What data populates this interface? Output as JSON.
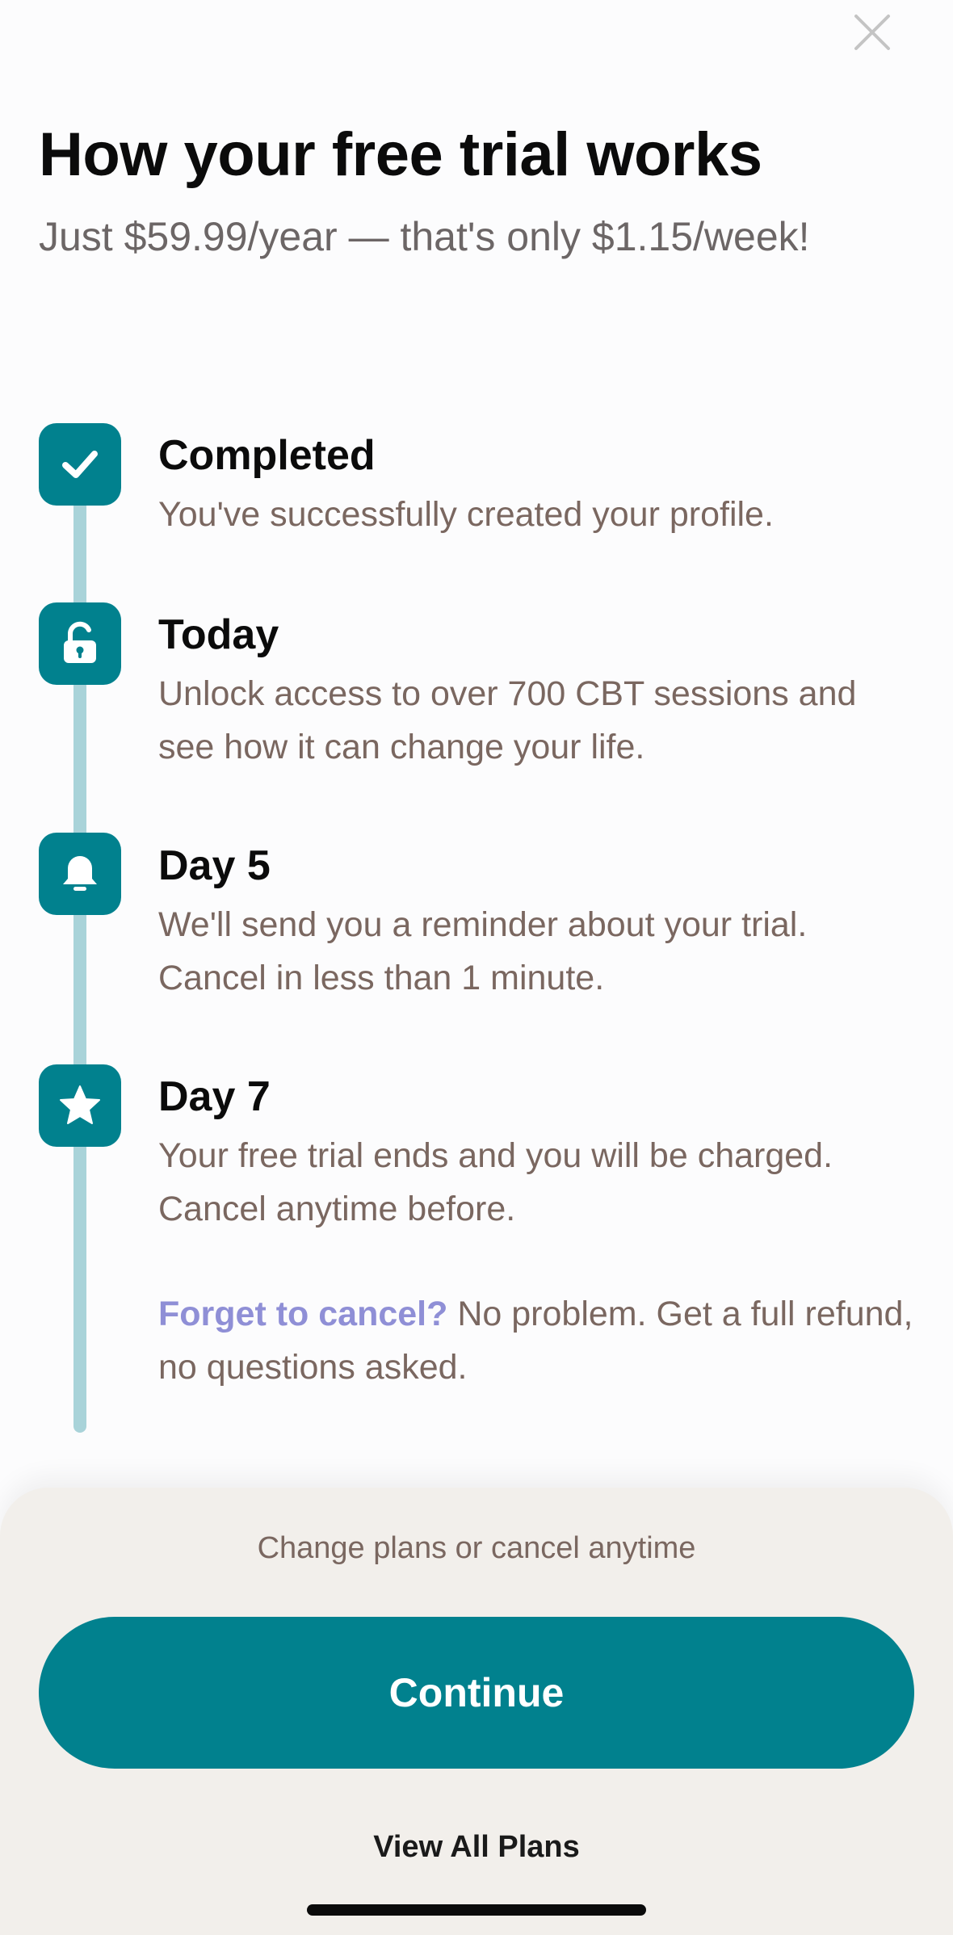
{
  "header": {
    "close_icon": "close-icon",
    "title": "How your free trial works",
    "subtitle": "Just $59.99/year — that's only $1.15/week!"
  },
  "timeline": {
    "steps": [
      {
        "icon": "checkmark-icon",
        "title": "Completed",
        "description": "You've successfully created your profile."
      },
      {
        "icon": "unlock-icon",
        "title": "Today",
        "description": "Unlock access to over 700 CBT sessions and see how it can change your life."
      },
      {
        "icon": "bell-icon",
        "title": "Day 5",
        "description": "We'll send you a reminder about your trial. Cancel in less than 1 minute."
      },
      {
        "icon": "star-icon",
        "title": "Day 7",
        "description": "Your free trial ends and you will be charged. Cancel anytime before."
      }
    ],
    "note": {
      "link_text": "Forget to cancel?",
      "text": " No problem. Get a full refund, no questions asked."
    }
  },
  "footer": {
    "change_note": "Change plans or cancel anytime",
    "continue_label": "Continue",
    "view_all_label": "View All Plans"
  },
  "colors": {
    "accent": "#01818e",
    "rail": "#a9d3d9",
    "link": "#8f8fd6",
    "muted_text": "#7a6760",
    "sheet_background": "#f2efeb"
  }
}
